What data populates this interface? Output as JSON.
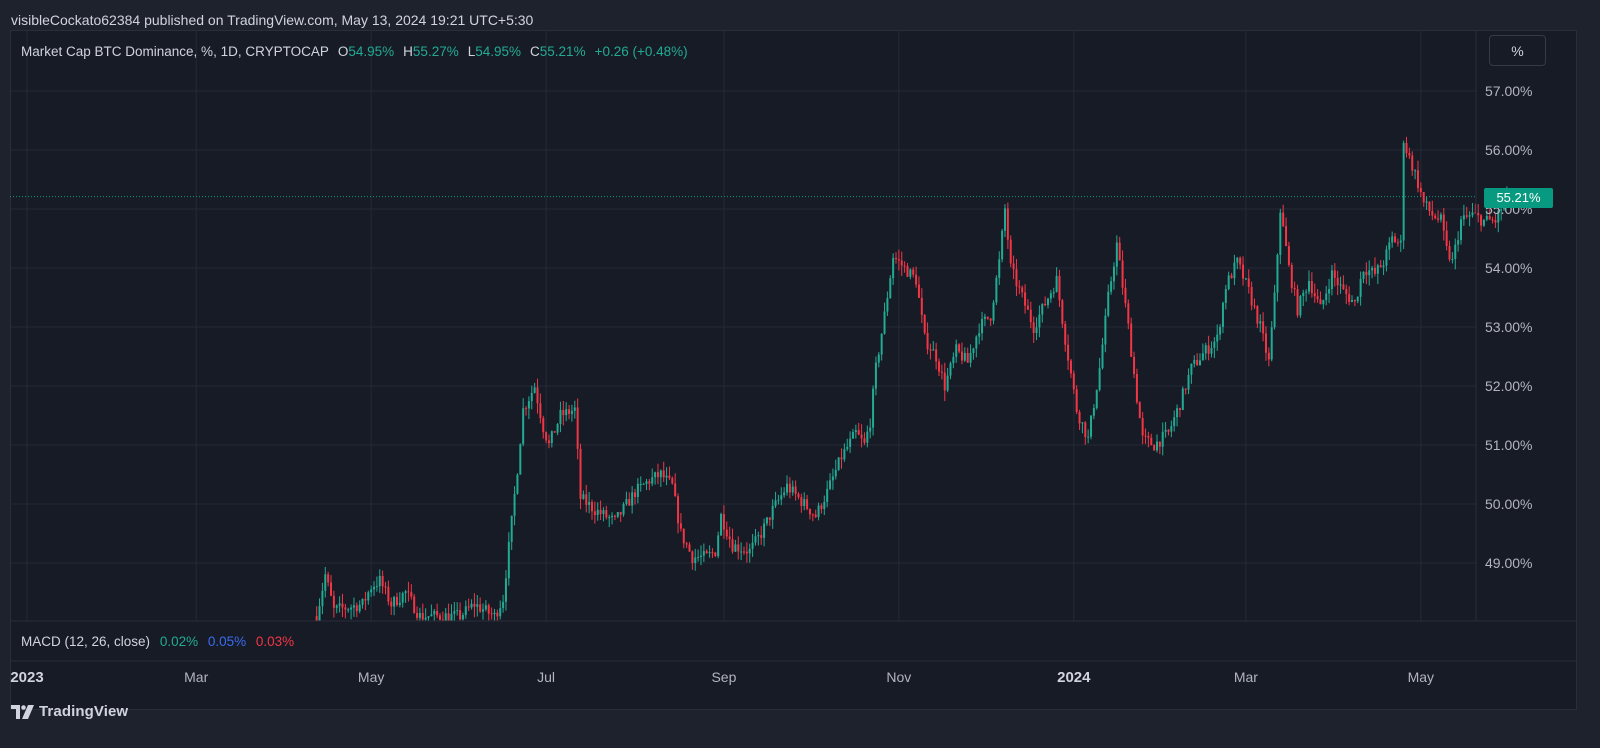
{
  "header": {
    "publisher": "visibleCockato62384 published on TradingView.com, May 13, 2024 19:21 UTC+5:30"
  },
  "legend": {
    "symbol": "Market Cap BTC Dominance, %, 1D, CRYPTOCAP",
    "open_key": "O",
    "open": "54.95%",
    "high_key": "H",
    "high": "55.27%",
    "low_key": "L",
    "low": "54.95%",
    "close_key": "C",
    "close": "55.21%",
    "change": "+0.26 (+0.48%)"
  },
  "scale_button": "%",
  "last_price_label": "55.21%",
  "macd": {
    "label": "MACD (12, 26, close)",
    "v1": "0.02%",
    "v2": "0.05%",
    "v3": "0.03%"
  },
  "brand": {
    "name": "TradingView"
  },
  "colors": {
    "up": "#22ab94",
    "down": "#f23645",
    "background": "#171b26",
    "grid": "#252a36",
    "price_line": "#089981"
  },
  "chart_data": {
    "type": "candlestick",
    "title": "Market Cap BTC Dominance, %, 1D, CRYPTOCAP",
    "ylim": [
      48.1,
      57.9
    ],
    "y_ticks": [
      "49.00%",
      "50.00%",
      "51.00%",
      "52.00%",
      "53.00%",
      "54.00%",
      "55.00%",
      "56.00%",
      "57.00%"
    ],
    "x_ticks": [
      {
        "label": "2023",
        "bold": true
      },
      {
        "label": "Mar",
        "bold": false
      },
      {
        "label": "May",
        "bold": false
      },
      {
        "label": "Jul",
        "bold": false
      },
      {
        "label": "Sep",
        "bold": false
      },
      {
        "label": "Nov",
        "bold": false
      },
      {
        "label": "2024",
        "bold": true
      },
      {
        "label": "Mar",
        "bold": false
      },
      {
        "label": "May",
        "bold": false
      }
    ],
    "x_tick_dates": [
      "2023-01-01",
      "2023-03-01",
      "2023-05-01",
      "2023-07-01",
      "2023-09-01",
      "2023-11-01",
      "2024-01-01",
      "2024-03-01",
      "2024-05-01"
    ],
    "start_date": "2023-01-01",
    "last_date": "2024-05-13",
    "last_close": 55.21,
    "path": [
      [
        "2023-04-12",
        48.1
      ],
      [
        "2023-04-15",
        48.8
      ],
      [
        "2023-04-18",
        48.2
      ],
      [
        "2023-04-28",
        48.3
      ],
      [
        "2023-05-01",
        48.6
      ],
      [
        "2023-05-04",
        48.7
      ],
      [
        "2023-05-08",
        48.3
      ],
      [
        "2023-05-13",
        48.5
      ],
      [
        "2023-05-18",
        48.1
      ],
      [
        "2023-06-01",
        48.1
      ],
      [
        "2023-06-06",
        48.3
      ],
      [
        "2023-06-13",
        48.1
      ],
      [
        "2023-06-16",
        48.4
      ],
      [
        "2023-06-19",
        49.7
      ],
      [
        "2023-06-21",
        50.6
      ],
      [
        "2023-06-23",
        51.6
      ],
      [
        "2023-06-27",
        52.0
      ],
      [
        "2023-06-30",
        51.3
      ],
      [
        "2023-07-02",
        51.0
      ],
      [
        "2023-07-06",
        51.5
      ],
      [
        "2023-07-11",
        51.6
      ],
      [
        "2023-07-13",
        50.1
      ],
      [
        "2023-07-18",
        49.9
      ],
      [
        "2023-07-25",
        49.7
      ],
      [
        "2023-08-01",
        50.2
      ],
      [
        "2023-08-06",
        50.4
      ],
      [
        "2023-08-10",
        50.5
      ],
      [
        "2023-08-14",
        50.3
      ],
      [
        "2023-08-17",
        49.5
      ],
      [
        "2023-08-21",
        49.1
      ],
      [
        "2023-08-26",
        49.1
      ],
      [
        "2023-08-29",
        49.2
      ],
      [
        "2023-08-31",
        49.8
      ],
      [
        "2023-09-04",
        49.3
      ],
      [
        "2023-09-10",
        49.2
      ],
      [
        "2023-09-14",
        49.5
      ],
      [
        "2023-09-18",
        49.9
      ],
      [
        "2023-09-23",
        50.3
      ],
      [
        "2023-09-29",
        50.0
      ],
      [
        "2023-10-03",
        49.8
      ],
      [
        "2023-10-07",
        50.2
      ],
      [
        "2023-10-12",
        50.8
      ],
      [
        "2023-10-17",
        51.2
      ],
      [
        "2023-10-20",
        51.0
      ],
      [
        "2023-10-22",
        51.4
      ],
      [
        "2023-10-24",
        52.3
      ],
      [
        "2023-10-27",
        53.2
      ],
      [
        "2023-10-30",
        54.2
      ],
      [
        "2023-11-03",
        54.0
      ],
      [
        "2023-11-07",
        53.8
      ],
      [
        "2023-11-10",
        52.8
      ],
      [
        "2023-11-14",
        52.5
      ],
      [
        "2023-11-17",
        52.0
      ],
      [
        "2023-11-21",
        52.6
      ],
      [
        "2023-11-25",
        52.4
      ],
      [
        "2023-11-29",
        53.0
      ],
      [
        "2023-12-03",
        53.2
      ],
      [
        "2023-12-06",
        54.1
      ],
      [
        "2023-12-08",
        55.0
      ],
      [
        "2023-12-10",
        54.0
      ],
      [
        "2023-12-14",
        53.5
      ],
      [
        "2023-12-18",
        53.0
      ],
      [
        "2023-12-22",
        53.4
      ],
      [
        "2023-12-26",
        53.8
      ],
      [
        "2023-12-29",
        52.8
      ],
      [
        "2024-01-02",
        51.6
      ],
      [
        "2024-01-06",
        51.1
      ],
      [
        "2024-01-10",
        52.3
      ],
      [
        "2024-01-13",
        53.5
      ],
      [
        "2024-01-16",
        54.4
      ],
      [
        "2024-01-20",
        53.0
      ],
      [
        "2024-01-23",
        51.8
      ],
      [
        "2024-01-25",
        51.1
      ],
      [
        "2024-01-29",
        51.0
      ],
      [
        "2024-02-03",
        51.2
      ],
      [
        "2024-02-07",
        51.7
      ],
      [
        "2024-02-11",
        52.3
      ],
      [
        "2024-02-16",
        52.6
      ],
      [
        "2024-02-20",
        52.8
      ],
      [
        "2024-02-23",
        53.7
      ],
      [
        "2024-02-27",
        54.1
      ],
      [
        "2024-03-02",
        53.6
      ],
      [
        "2024-03-06",
        53.0
      ],
      [
        "2024-03-09",
        52.4
      ],
      [
        "2024-03-11",
        53.5
      ],
      [
        "2024-03-13",
        55.0
      ],
      [
        "2024-03-16",
        54.0
      ],
      [
        "2024-03-19",
        53.3
      ],
      [
        "2024-03-23",
        53.8
      ],
      [
        "2024-03-27",
        53.3
      ],
      [
        "2024-03-31",
        53.9
      ],
      [
        "2024-04-04",
        53.6
      ],
      [
        "2024-04-08",
        53.4
      ],
      [
        "2024-04-11",
        54.0
      ],
      [
        "2024-04-15",
        53.9
      ],
      [
        "2024-04-18",
        54.1
      ],
      [
        "2024-04-21",
        54.5
      ],
      [
        "2024-04-24",
        54.4
      ],
      [
        "2024-04-25",
        56.2
      ],
      [
        "2024-04-26",
        56.0
      ],
      [
        "2024-04-29",
        55.6
      ],
      [
        "2024-05-02",
        55.1
      ],
      [
        "2024-05-05",
        54.9
      ],
      [
        "2024-05-08",
        54.8
      ],
      [
        "2024-05-10",
        54.3
      ],
      [
        "2024-05-12",
        54.1
      ],
      [
        "2024-05-15",
        54.8
      ],
      [
        "2024-05-19",
        54.9
      ],
      [
        "2024-05-23",
        54.8
      ],
      [
        "2024-05-27",
        54.8
      ],
      [
        "2024-05-31",
        55.21
      ]
    ]
  }
}
